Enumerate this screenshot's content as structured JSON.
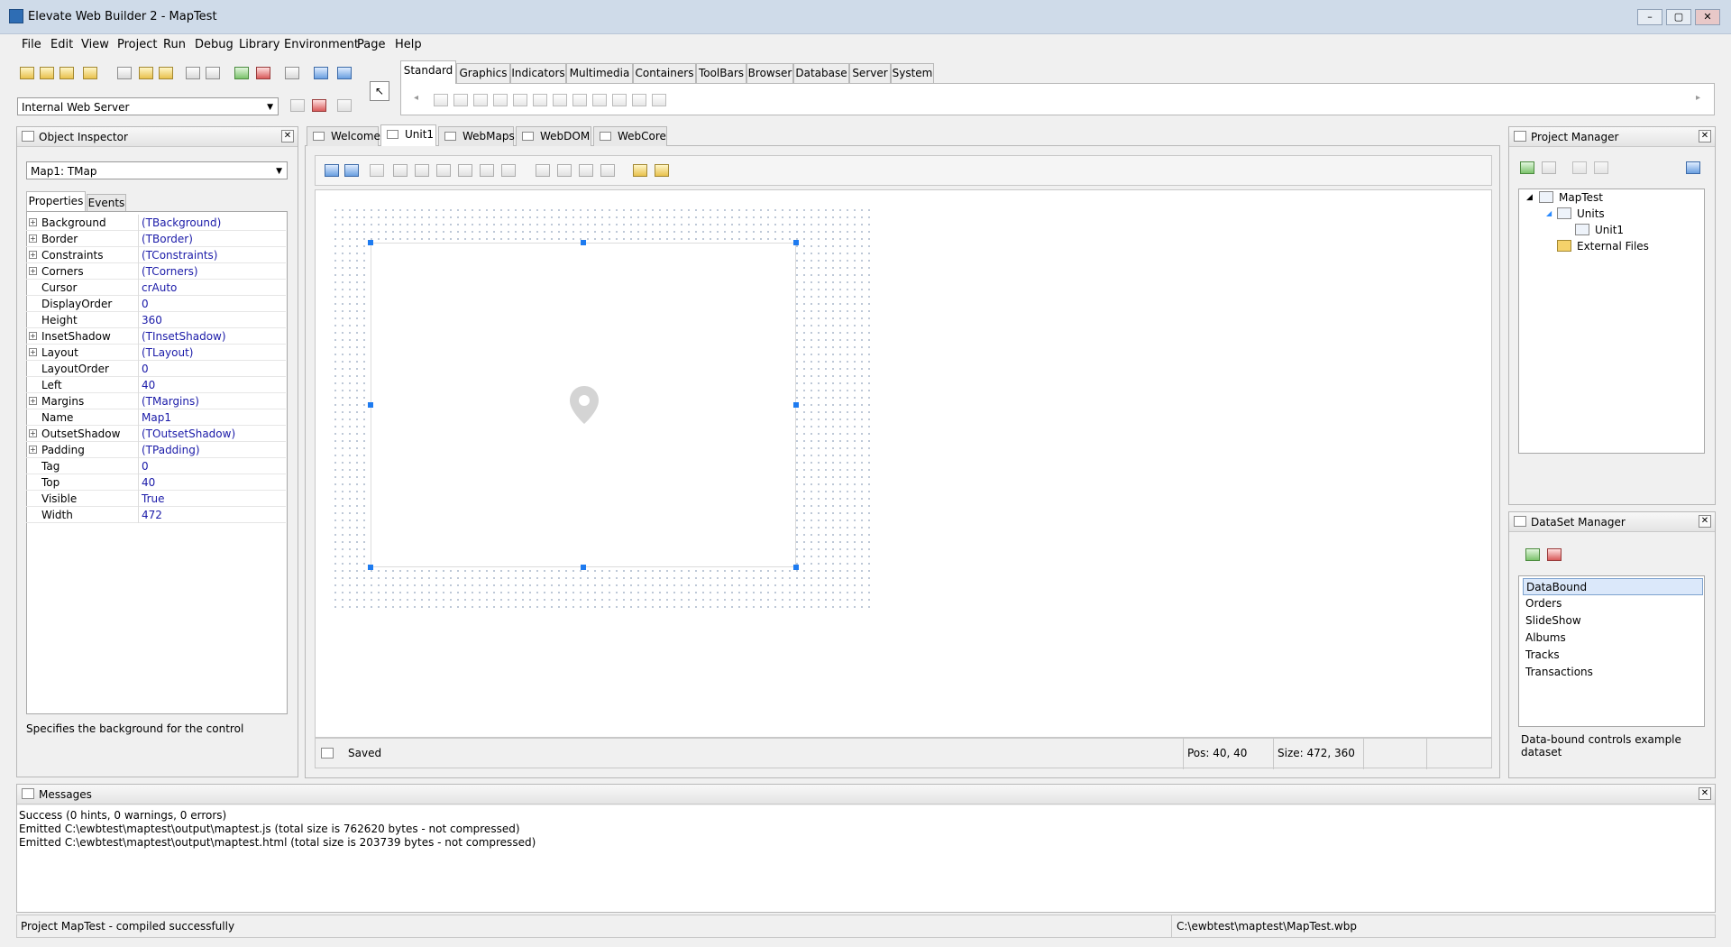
{
  "window": {
    "title": "Elevate Web Builder 2 - MapTest",
    "controls": [
      "–",
      "▢",
      "✕"
    ]
  },
  "menu": [
    "File",
    "Edit",
    "View",
    "Project",
    "Run",
    "Debug",
    "Library",
    "Environment",
    "Page",
    "Help"
  ],
  "toolbar": {
    "server_select": "Internal Web Server"
  },
  "palette": {
    "tabs": [
      "Standard",
      "Graphics",
      "Indicators",
      "Multimedia",
      "Containers",
      "ToolBars",
      "Browser",
      "Database",
      "Server",
      "System"
    ],
    "active_tab": "Standard",
    "scroll_left": "◂",
    "scroll_right": "▸"
  },
  "object_inspector": {
    "title": "Object Inspector",
    "selected_component": "Map1: TMap",
    "tabs": [
      "Properties",
      "Events"
    ],
    "properties": [
      {
        "name": "Background",
        "value": "(TBackground)",
        "expandable": true
      },
      {
        "name": "Border",
        "value": "(TBorder)",
        "expandable": true
      },
      {
        "name": "Constraints",
        "value": "(TConstraints)",
        "expandable": true
      },
      {
        "name": "Corners",
        "value": "(TCorners)",
        "expandable": true
      },
      {
        "name": "Cursor",
        "value": "crAuto",
        "expandable": false
      },
      {
        "name": "DisplayOrder",
        "value": "0",
        "expandable": false
      },
      {
        "name": "Height",
        "value": "360",
        "expandable": false
      },
      {
        "name": "InsetShadow",
        "value": "(TInsetShadow)",
        "expandable": true
      },
      {
        "name": "Layout",
        "value": "(TLayout)",
        "expandable": true
      },
      {
        "name": "LayoutOrder",
        "value": "0",
        "expandable": false
      },
      {
        "name": "Left",
        "value": "40",
        "expandable": false
      },
      {
        "name": "Margins",
        "value": "(TMargins)",
        "expandable": true
      },
      {
        "name": "Name",
        "value": "Map1",
        "expandable": false
      },
      {
        "name": "OutsetShadow",
        "value": "(TOutsetShadow)",
        "expandable": true
      },
      {
        "name": "Padding",
        "value": "(TPadding)",
        "expandable": true
      },
      {
        "name": "Tag",
        "value": "0",
        "expandable": false
      },
      {
        "name": "Top",
        "value": "40",
        "expandable": false
      },
      {
        "name": "Visible",
        "value": "True",
        "expandable": false
      },
      {
        "name": "Width",
        "value": "472",
        "expandable": false
      }
    ],
    "description": "Specifies the background for the control"
  },
  "editor": {
    "tabs": [
      "Welcome",
      "Unit1",
      "WebMaps",
      "WebDOM",
      "WebCore"
    ],
    "active_tab": "Unit1",
    "status": {
      "text": "Saved",
      "pos": "Pos: 40, 40",
      "size": "Size: 472, 360"
    }
  },
  "project_manager": {
    "title": "Project Manager",
    "tree": {
      "root": "MapTest",
      "units": "Units",
      "unit1": "Unit1",
      "external": "External Files"
    }
  },
  "dataset_manager": {
    "title": "DataSet Manager",
    "items": [
      "DataBound",
      "Orders",
      "SlideShow",
      "Albums",
      "Tracks",
      "Transactions"
    ],
    "selected": "DataBound",
    "description": "Data-bound controls example dataset"
  },
  "messages": {
    "title": "Messages",
    "lines": [
      "Success (0 hints, 0 warnings, 0 errors)",
      "Emitted C:\\ewbtest\\maptest\\output\\maptest.js (total size is 762620 bytes - not compressed)",
      "Emitted C:\\ewbtest\\maptest\\output\\maptest.html (total size is 203739 bytes - not compressed)"
    ]
  },
  "statusbar": {
    "left": "Project MapTest - compiled successfully",
    "right": "C:\\ewbtest\\maptest\\MapTest.wbp"
  }
}
